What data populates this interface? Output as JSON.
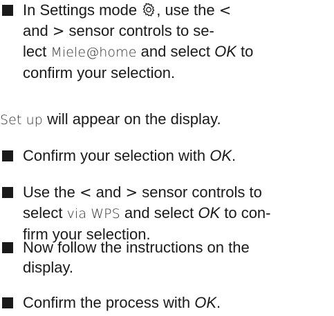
{
  "steps": [
    {
      "lines": [
        {
          "a": "In Settings mode ",
          "b": ", use the ",
          "c": "<"
        },
        {
          "a": "and ",
          "b": ">",
          "c": " sensor controls to se-"
        },
        {
          "a": "lect ",
          "b": "Miele@home",
          "c": " and select ",
          "d": "OK",
          "e": " to"
        },
        {
          "a": "confirm your selection."
        }
      ]
    },
    {
      "lines": [
        {
          "a": "Confirm your selection with ",
          "b": "OK",
          "c": "."
        }
      ]
    },
    {
      "lines": [
        {
          "a": "Use the ",
          "b": "<",
          "c": " and ",
          "d": ">",
          "e": " sensor controls to"
        },
        {
          "a": "select ",
          "b": "via WPS",
          "c": " and select ",
          "d": "OK",
          "e": " to con-"
        },
        {
          "a": "firm your selection."
        }
      ]
    },
    {
      "lines": [
        {
          "a": "Now follow the instructions on the"
        },
        {
          "a": "display."
        }
      ]
    },
    {
      "lines": [
        {
          "a": "Confirm the process with ",
          "b": "OK",
          "c": "."
        }
      ]
    }
  ],
  "note": {
    "display_text": "Set up",
    "rest": " will appear on the display."
  },
  "icons": {
    "settings": "gear-icon",
    "bullet": "square-bullet-icon"
  },
  "colors": {
    "text": "#1a1a1a",
    "display_text": "#333333"
  }
}
